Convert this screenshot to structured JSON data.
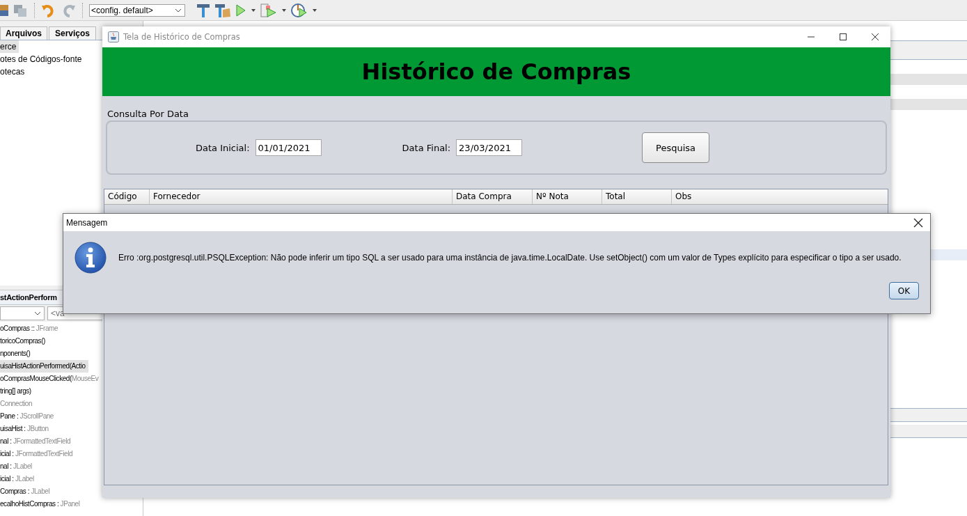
{
  "ide": {
    "toolbar": {
      "config": "<config. default>"
    },
    "panel_tabs": [
      {
        "label": "Arquivos"
      },
      {
        "label": "Serviços"
      }
    ],
    "project_tree": [
      {
        "label": "erce",
        "selected": true
      },
      {
        "label": "otes de Códigos-fonte",
        "selected": false
      },
      {
        "label": "otecas",
        "selected": false
      }
    ],
    "navigator": {
      "title": "stActionPerform",
      "filter": "<va",
      "members": [
        {
          "name": "oCompras ::",
          "type": "JFrame",
          "selected": false
        },
        {
          "name": "toricoCompras()",
          "selected": false
        },
        {
          "name": "nponents()",
          "selected": false
        },
        {
          "name": "uisaHistActionPerformed(Actio",
          "selected": true
        },
        {
          "name": "oComprasMouseClicked(",
          "type": "MouseEv",
          "selected": false
        },
        {
          "name": "tring[] args)",
          "selected": false
        },
        {
          "type": "Connection",
          "selected": false
        },
        {
          "name": "Pane :",
          "type": "JScrollPane",
          "selected": false
        },
        {
          "name": "uisaHist :",
          "type": "JButton",
          "selected": false
        },
        {
          "name": "nal :",
          "type": "JFormattedTextField",
          "selected": false
        },
        {
          "name": "icial :",
          "type": "JFormattedTextField",
          "selected": false
        },
        {
          "name": "nal :",
          "type": "JLabel",
          "selected": false
        },
        {
          "name": "icial :",
          "type": "JLabel",
          "selected": false
        },
        {
          "name": "Compras :",
          "type": "JLabel",
          "selected": false
        },
        {
          "name": "ecalhoHistCompras :",
          "type": "JPanel",
          "selected": false
        }
      ]
    }
  },
  "window": {
    "title": "Tela de Histórico de Compras",
    "header": "Histórico de Compras",
    "group_title": "Consulta Por Data",
    "fields": [
      {
        "label": "Data Inicial:",
        "value": "01/01/2021"
      },
      {
        "label": "Data Final:",
        "value": "23/03/2021"
      }
    ],
    "search_button": "Pesquisa",
    "table": {
      "columns": [
        "Código",
        "Fornecedor",
        "Data Compra",
        "Nº Nota",
        "Total",
        "Obs"
      ]
    }
  },
  "dialog": {
    "title": "Mensagem",
    "message": "Erro :org.postgresql.util.PSQLException: Não pode inferir um tipo SQL a ser usado para uma instância de java.time.LocalDate. Use setObject() com um valor de Types explícito para especificar o tipo a ser usado.",
    "button": "OK"
  }
}
